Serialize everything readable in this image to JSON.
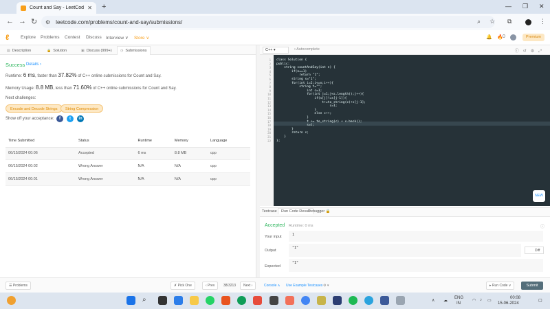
{
  "browser": {
    "tab_title": "Count and Say - LeetCode",
    "url": "leetcode.com/problems/count-and-say/submissions/"
  },
  "lc_nav": {
    "items": [
      "Explore",
      "Problems",
      "Contest",
      "Discuss",
      "Interview ∨",
      "Store ∨"
    ],
    "notif_count": "0",
    "premium": "Premium"
  },
  "left_tabs": [
    "Description",
    "Solution",
    "Discuss (999+)",
    "Submissions"
  ],
  "result": {
    "status": "Success",
    "details": "Details ›",
    "runtime_prefix": "Runtime: ",
    "runtime_value": "6 ms",
    "runtime_mid": ", faster than ",
    "runtime_pct": "37.82%",
    "runtime_suffix": " of C++ online submissions for Count and Say.",
    "memory_prefix": "Memory Usage: ",
    "memory_value": "8.8 MB",
    "memory_mid": ", less than ",
    "memory_pct": "71.60%",
    "memory_suffix": " of C++ online submissions for Count and Say.",
    "next_challenges": "Next challenges:",
    "challenges": [
      "Encode and Decode Strings",
      "String Compression"
    ],
    "share": "Show off your acceptance:"
  },
  "submissions": {
    "headers": [
      "Time Submitted",
      "Status",
      "Runtime",
      "Memory",
      "Language"
    ],
    "rows": [
      [
        "06/15/2024 00:06",
        "Accepted",
        "6 ms",
        "8.8 MB",
        "cpp"
      ],
      [
        "06/15/2024 00:02",
        "Wrong Answer",
        "N/A",
        "N/A",
        "cpp"
      ],
      [
        "06/15/2024 00:01",
        "Wrong Answer",
        "N/A",
        "N/A",
        "cpp"
      ]
    ]
  },
  "editor": {
    "language": "C++",
    "autocomplete": "• Autocomplete",
    "code_lines": [
      "class Solution {",
      "public:",
      "    string countAndSay(int n) {",
      "        if(n==1)",
      "            return \"1\";",
      "        string s=\"1\";",
      "        for(int i=2;i<=n;i++){",
      "            string t=\"\";",
      "                int c=1;",
      "                for(int j=1;j<s.length();j++){",
      "                    if(s[j]!=s[j-1]){",
      "                        t+=to_string(c)+s[j-1];",
      "                            c=1;",
      "                    }",
      "                    else c++;",
      "                }",
      "                t += to_string(c) + s.back();",
      "                s=t;",
      "        }",
      "        return s;",
      "    }",
      "};"
    ],
    "new_label": "NEW"
  },
  "console": {
    "tabs": [
      "Testcase",
      "Run Code Result",
      "Debugger 🔒"
    ],
    "status": "Accepted",
    "runtime": "Runtime: 0 ms",
    "your_input_label": "Your input",
    "your_input": "1",
    "output_label": "Output",
    "output": "\"1\"",
    "expected_label": "Expected",
    "expected": "\"1\"",
    "diff": "Diff"
  },
  "bottom": {
    "problems": "☰ Problems",
    "pick_one": "✗ Pick One",
    "prev": "‹ Prev",
    "page": "38/3213",
    "next": "Next ›",
    "console": "Console ∧",
    "use_example": "Use Example Testcases",
    "run_code": "▸ Run Code ∨",
    "submit": "Submit"
  },
  "taskbar": {
    "lang_top": "ENG",
    "lang_bottom": "IN",
    "time": "00:08",
    "date": "15-06-2024"
  }
}
